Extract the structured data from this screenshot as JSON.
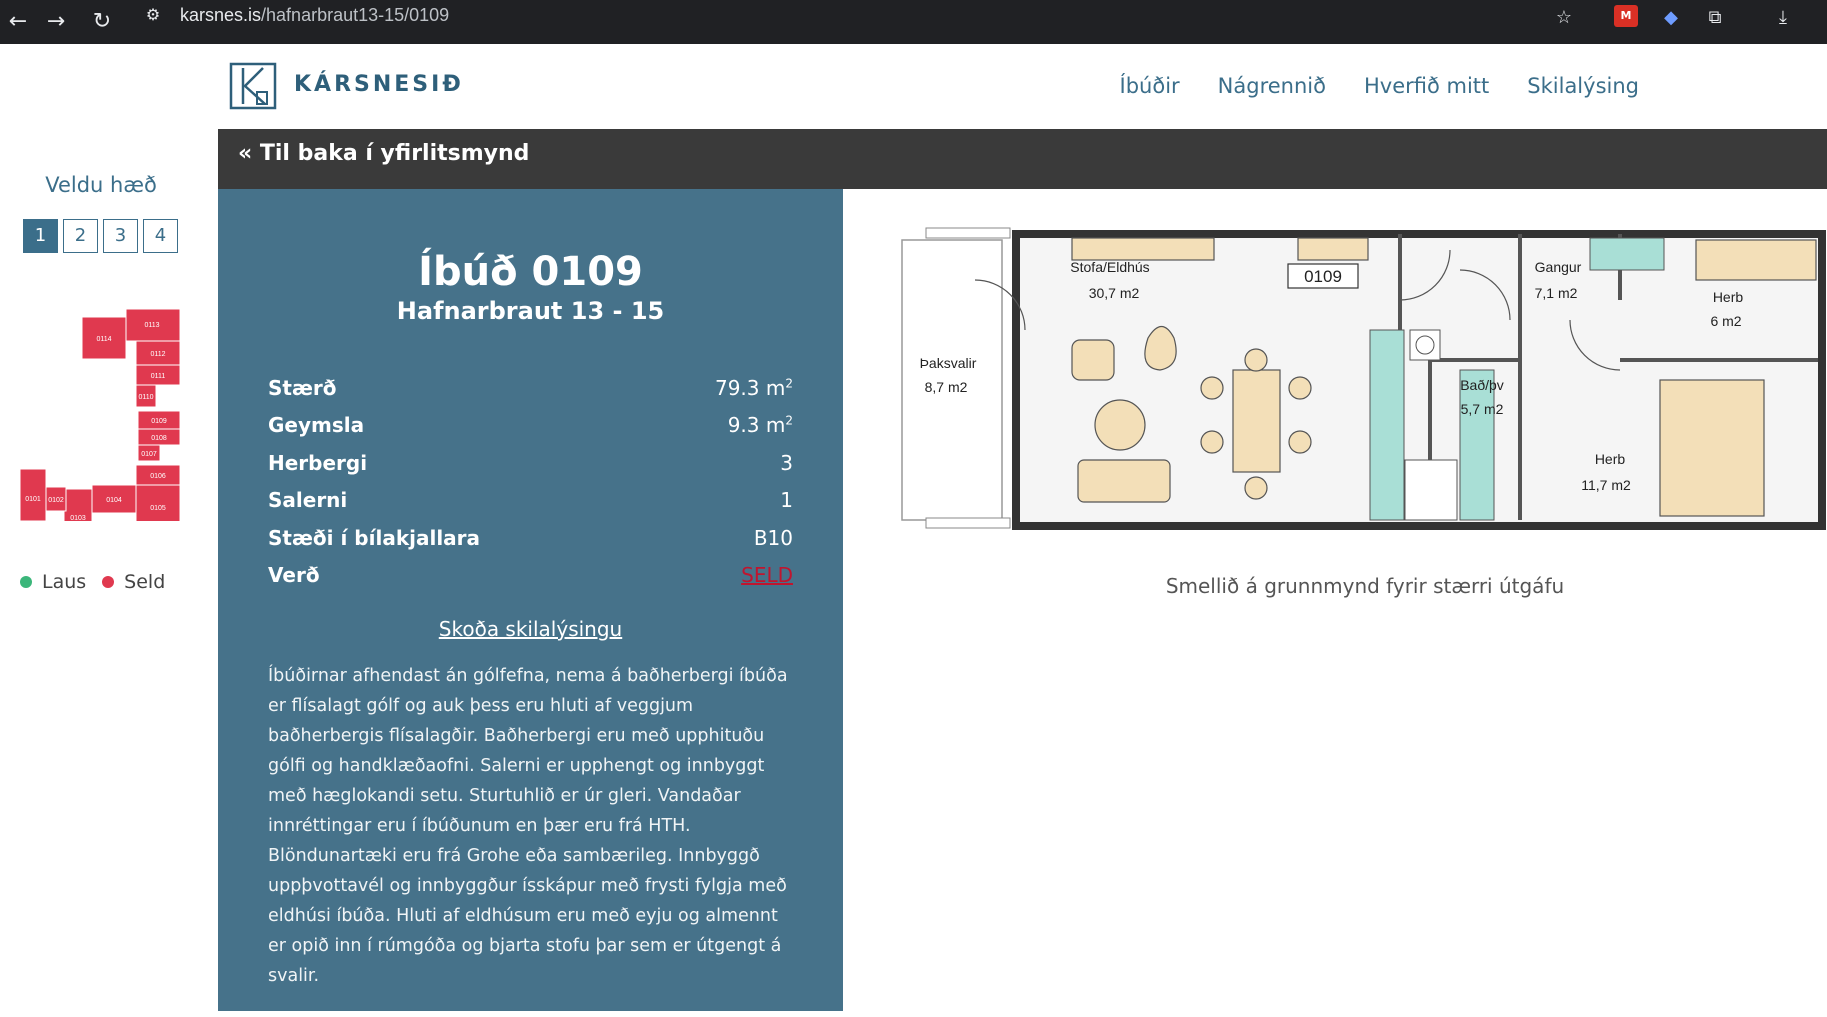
{
  "browser": {
    "url_host": "karsnes.is",
    "url_path": "/hafnarbraut13-15/0109",
    "ext_badge": "M"
  },
  "header": {
    "logo_text": "KÁRSNESIÐ",
    "nav": [
      "Íbúðir",
      "Nágrennið",
      "Hverfið mitt",
      "Skilalýsing"
    ]
  },
  "sidebar": {
    "title": "Veldu hæð",
    "floors": [
      "1",
      "2",
      "3",
      "4"
    ],
    "active_floor": "1",
    "map_units": [
      "0114",
      "0113",
      "0112",
      "0111",
      "0110",
      "0109",
      "0108",
      "0107",
      "0106",
      "0105",
      "0104",
      "0103",
      "0102",
      "0101"
    ],
    "legend": [
      {
        "label": "Laus",
        "color": "#3bb67a"
      },
      {
        "label": "Seld",
        "color": "#e0394f"
      }
    ]
  },
  "back_link": "« Til baka í yfirlitsmynd",
  "apartment": {
    "title": "Íbúð 0109",
    "address": "Hafnarbraut 13 - 15",
    "specs": [
      {
        "label": "Stærð",
        "value": "79.3 m",
        "sup": "2"
      },
      {
        "label": "Geymsla",
        "value": "9.3 m",
        "sup": "2"
      },
      {
        "label": "Herbergi",
        "value": "3"
      },
      {
        "label": "Salerni",
        "value": "1"
      },
      {
        "label": "Stæði í bílakjallara",
        "value": "B10"
      },
      {
        "label": "Verð",
        "value": "SELD"
      }
    ],
    "skil_link": "Skoða skilalýsingu",
    "description": "Íbúðirnar afhendast án gólfefna, nema á baðherbergi íbúða er flísalagt gólf og auk þess eru hluti af veggjum baðherbergis flísalagðir. Baðherbergi eru með upphituðu gólfi og handklæðaofni. Salerni er upphengt og innbyggt með hæglokandi setu. Sturtuhlið er úr gleri. Vandaðar innréttingar eru í íbúðunum en þær eru frá HTH. Blöndunartæki eru frá Grohe eða sambærileg. Innbyggð uppþvottavél og innbyggður ísskápur með frysti fylgja með eldhúsi íbúða. Hluti af eldhúsum eru með eyju og almennt er opið inn í rúmgóða og bjarta stofu þar sem er útgengt á svalir."
  },
  "plan": {
    "label": "0109",
    "rooms": [
      {
        "name": "Stofa/Eldhús",
        "area": "30,7 m2"
      },
      {
        "name": "Gangur",
        "area": "7,1 m2"
      },
      {
        "name": "Herb",
        "area": "6 m2"
      },
      {
        "name": "Þaksvalir",
        "area": "8,7 m2"
      },
      {
        "name": "Bað/þv",
        "area": "5,7 m2"
      },
      {
        "name": "Herb",
        "area": "11,7 m2"
      }
    ],
    "caption": "Smellið á grunnmynd fyrir stærri útgáfu"
  }
}
